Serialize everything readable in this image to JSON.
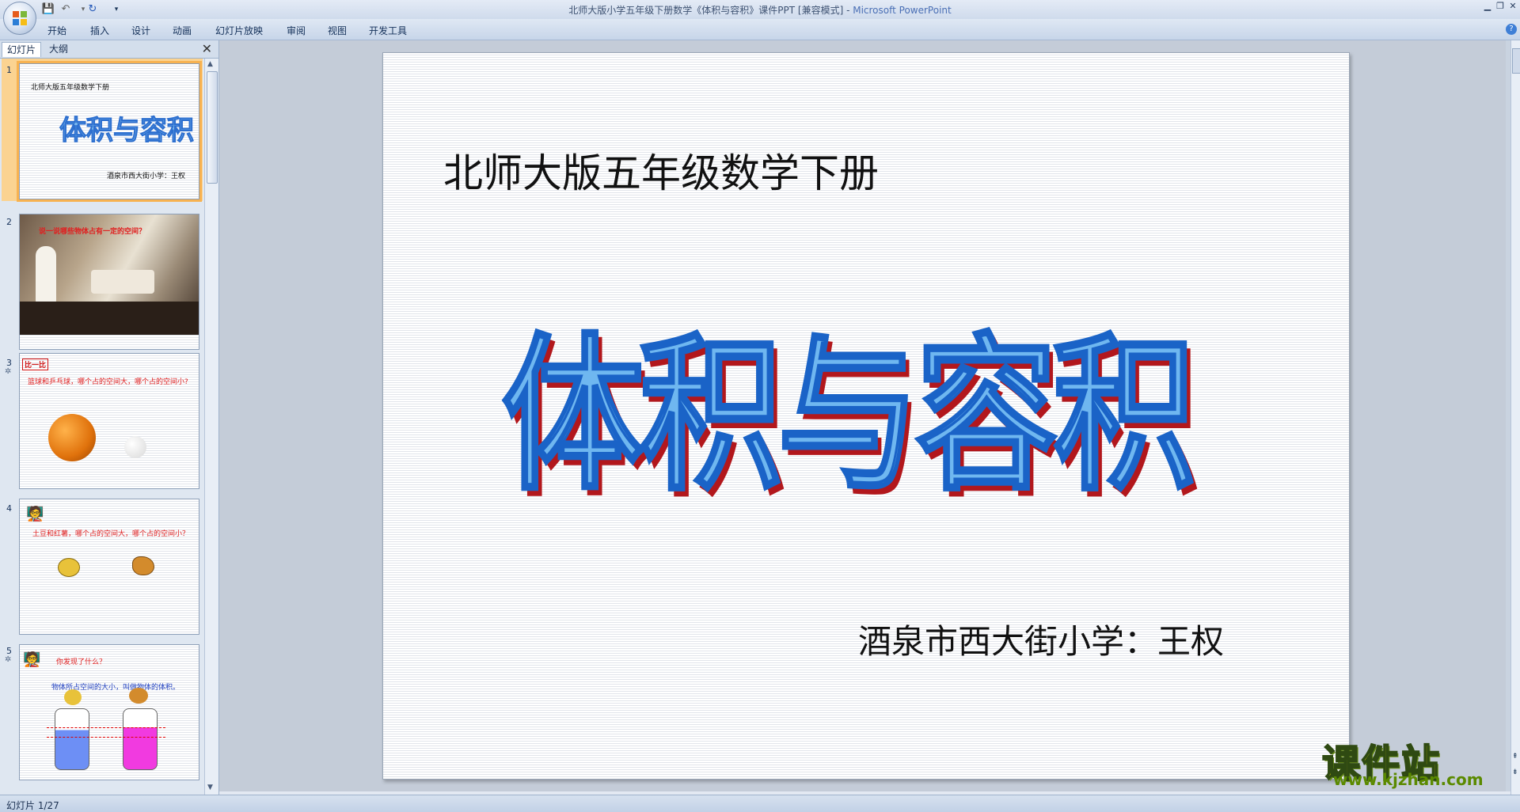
{
  "window": {
    "title": "北师大版小学五年级下册数学《体积与容积》课件PPT [兼容模式] - ",
    "app_name": "Microsoft PowerPoint"
  },
  "ribbon": {
    "tabs": [
      "开始",
      "插入",
      "设计",
      "动画",
      "幻灯片放映",
      "审阅",
      "视图",
      "开发工具"
    ]
  },
  "panel": {
    "tab_slides": "幻灯片",
    "tab_outline": "大纲"
  },
  "thumbnails": [
    {
      "num": "1",
      "lines": [
        "北师大版五年级数学下册",
        "体积与容积",
        "酒泉市西大街小学：王权"
      ]
    },
    {
      "num": "2",
      "lines": [
        "说一说哪些物体占有一定的空间？"
      ]
    },
    {
      "num": "3",
      "lines": [
        "比一比",
        "篮球和乒乓球，哪个占的空间大，哪个占的空间小?"
      ]
    },
    {
      "num": "4",
      "lines": [
        "土豆和红薯，哪个占的空间大，哪个占的空间小？"
      ]
    },
    {
      "num": "5",
      "lines": [
        "你发现了什么？",
        "物体所占空间的大小，叫做物体的体积。"
      ]
    }
  ],
  "slide": {
    "subtitle": "北师大版五年级数学下册",
    "title": "体积与容积",
    "author": "酒泉市西大街小学：王权"
  },
  "status": {
    "text": "幻灯片 1/27"
  },
  "watermark": {
    "text": "课件站",
    "url": "www.kjzhan.com"
  }
}
